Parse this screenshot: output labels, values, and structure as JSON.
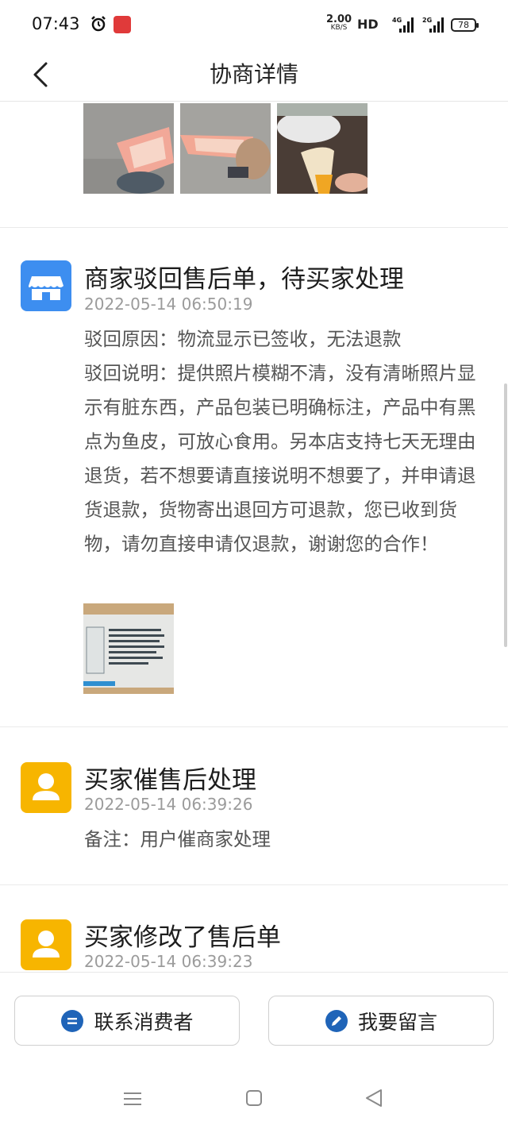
{
  "status_bar": {
    "time": "07:43",
    "net_speed_value": "2.00",
    "net_speed_unit": "KB/S",
    "hd_label": "HD",
    "signal_1_label": "4G",
    "signal_2_label": "2G",
    "battery": "78"
  },
  "nav": {
    "title": "协商详情",
    "back_icon": "chevron-left-icon"
  },
  "entries": [
    {
      "title": "商家驳回售后单，待买家处理",
      "time": "2022-05-14 06:50:19",
      "avatar_icon": "store-icon",
      "avatar_color": "#3d8ef0",
      "lines": [
        "驳回原因：物流显示已签收，无法退款",
        "驳回说明：提供照片模糊不清，没有清晰照片显示有脏东西，产品包装已明确标注，产品中有黑点为鱼皮，可放心食用。另本店支持七天无理由退货，若不想要请直接说明不想要了，并申请退货退款，货物寄出退回方可退款，您已收到货物，请勿直接申请仅退款，谢谢您的合作！"
      ]
    },
    {
      "title": "买家催售后处理",
      "time": "2022-05-14 06:39:26",
      "avatar_icon": "user-icon",
      "avatar_color": "#f7b500",
      "lines": [
        "备注：用户催商家处理"
      ]
    },
    {
      "title": "买家修改了售后单",
      "time": "2022-05-14 06:39:23",
      "avatar_icon": "user-icon",
      "avatar_color": "#f7b500",
      "lines": []
    }
  ],
  "actions": {
    "contact_label": "联系消费者",
    "message_label": "我要留言"
  },
  "colors": {
    "accent_blue": "#3d8ef0",
    "accent_yellow": "#f7b500",
    "icon_dark_blue": "#1f64b8"
  }
}
